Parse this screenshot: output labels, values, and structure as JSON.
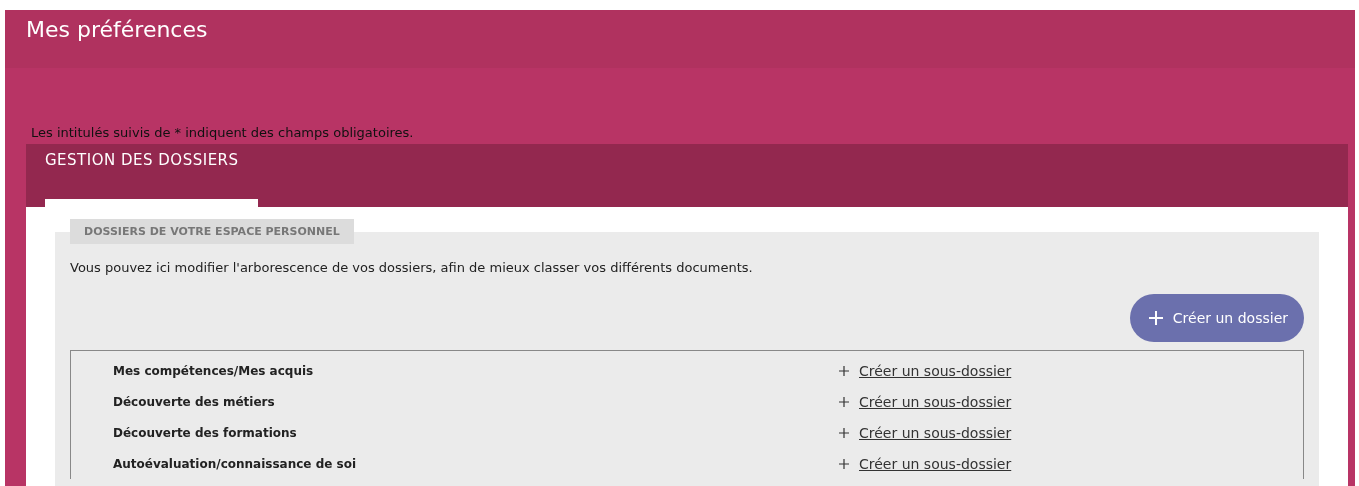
{
  "page_title": "Mes préférences",
  "required_note": "Les intitulés suivis de * indiquent des champs obligatoires.",
  "tabs": [
    {
      "label": "GESTION DES DOSSIERS",
      "selected": true
    }
  ],
  "section": {
    "legend": "DOSSIERS DE VOTRE ESPACE PERSONNEL",
    "description": "Vous pouvez ici modifier l'arborescence de vos dossiers, afin de mieux classer vos différents documents.",
    "create_button": "Créer un dossier",
    "folders": [
      {
        "name": "Mes compétences/Mes acquis",
        "action": "Créer un sous-dossier"
      },
      {
        "name": "Découverte des métiers",
        "action": "Créer un sous-dossier"
      },
      {
        "name": "Découverte des formations",
        "action": "Créer un sous-dossier"
      },
      {
        "name": "Autoévaluation/connaissance de soi",
        "action": "Créer un sous-dossier"
      }
    ]
  }
}
